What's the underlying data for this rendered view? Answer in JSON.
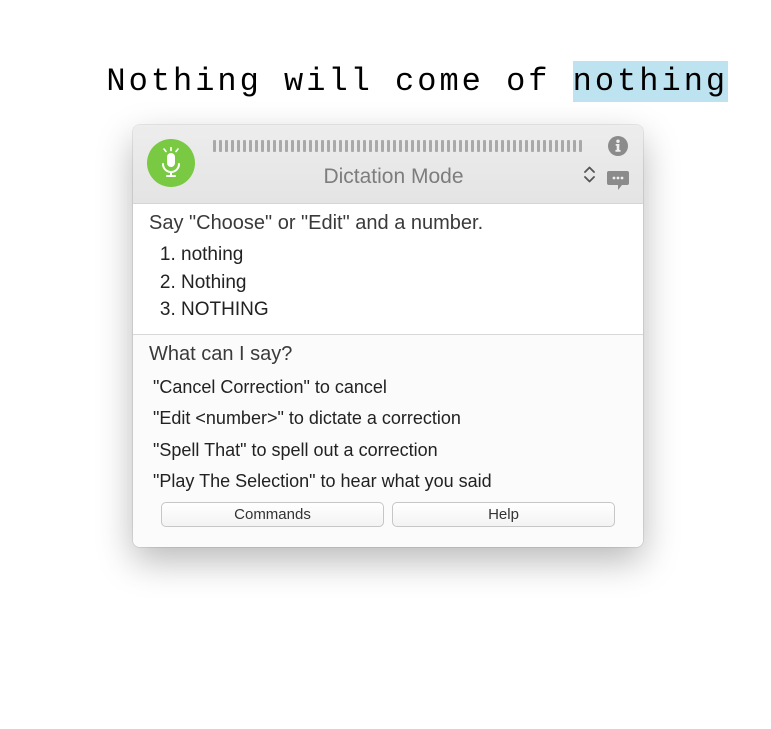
{
  "text_line": {
    "prefix": "Nothing will come of ",
    "selected": "nothing"
  },
  "panel": {
    "mode_title": "Dictation Mode",
    "choices_heading": "Say \"Choose\" or \"Edit\" and a number.",
    "choices": [
      "nothing",
      "Nothing",
      "NOTHING"
    ],
    "help_heading": "What can I say?",
    "tips": [
      "\"Cancel Correction\" to cancel",
      "\"Edit <number>\" to dictate a correction",
      "\"Spell That\" to spell out a correction",
      "\"Play The Selection\" to hear what you said"
    ],
    "buttons": {
      "commands": "Commands",
      "help": "Help"
    }
  },
  "colors": {
    "mic_green": "#79c943",
    "selection_bg": "#bde3f0"
  }
}
